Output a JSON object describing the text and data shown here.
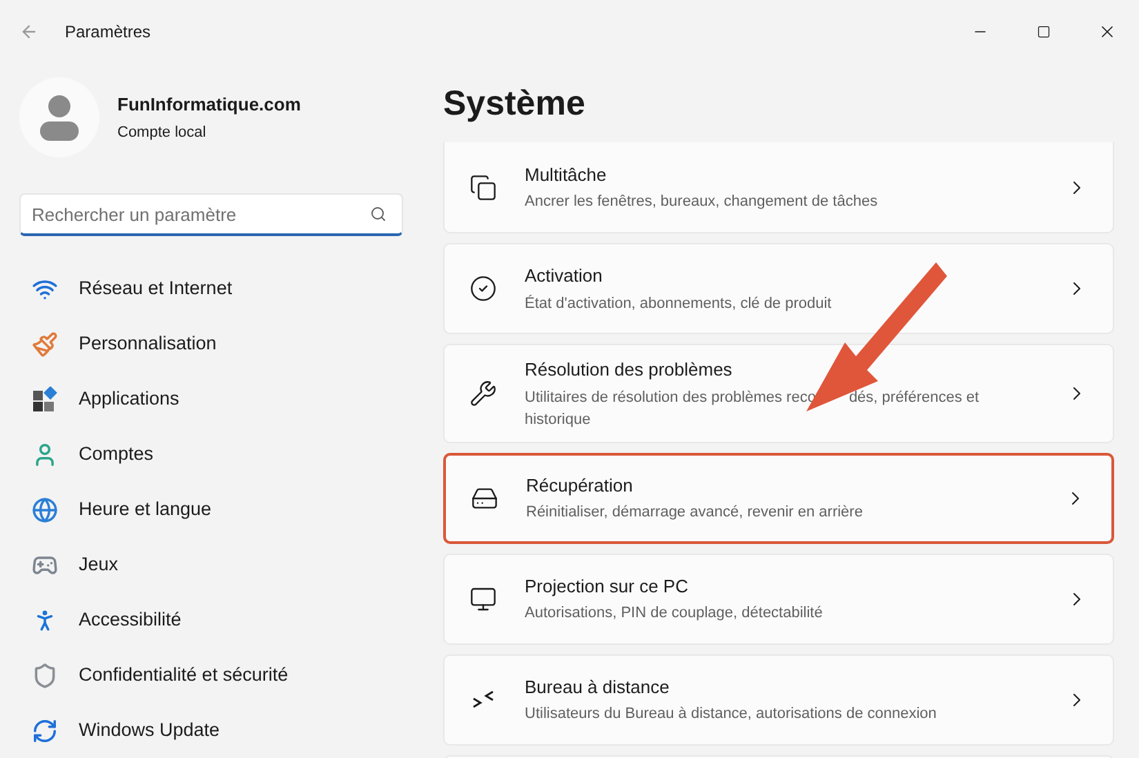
{
  "window": {
    "title": "Paramètres"
  },
  "account": {
    "name": "FunInformatique.com",
    "type": "Compte local"
  },
  "search": {
    "placeholder": "Rechercher un paramètre"
  },
  "sidebar": {
    "items": [
      {
        "label": "Réseau et Internet"
      },
      {
        "label": "Personnalisation"
      },
      {
        "label": "Applications"
      },
      {
        "label": "Comptes"
      },
      {
        "label": "Heure et langue"
      },
      {
        "label": "Jeux"
      },
      {
        "label": "Accessibilité"
      },
      {
        "label": "Confidentialité et sécurité"
      },
      {
        "label": "Windows Update"
      }
    ]
  },
  "page": {
    "title": "Système",
    "items": [
      {
        "title": "Multitâche",
        "description": "Ancrer les fenêtres, bureaux, changement de tâches",
        "highlighted": false
      },
      {
        "title": "Activation",
        "description": "État d'activation, abonnements, clé de produit",
        "highlighted": false
      },
      {
        "title": "Résolution des problèmes",
        "description": "Utilitaires de résolution des problèmes reco",
        "description_after": "dés, préférences et",
        "description_line_2": "historique",
        "highlighted": false
      },
      {
        "title": "Récupération",
        "description": "Réinitialiser, démarrage avancé, revenir en arrière",
        "highlighted": true
      },
      {
        "title": "Projection sur ce PC",
        "description": "Autorisations, PIN de couplage, détectabilité",
        "highlighted": false
      },
      {
        "title": "Bureau à distance",
        "description": "Utilisateurs du Bureau à distance, autorisations de connexion",
        "highlighted": false
      }
    ]
  }
}
